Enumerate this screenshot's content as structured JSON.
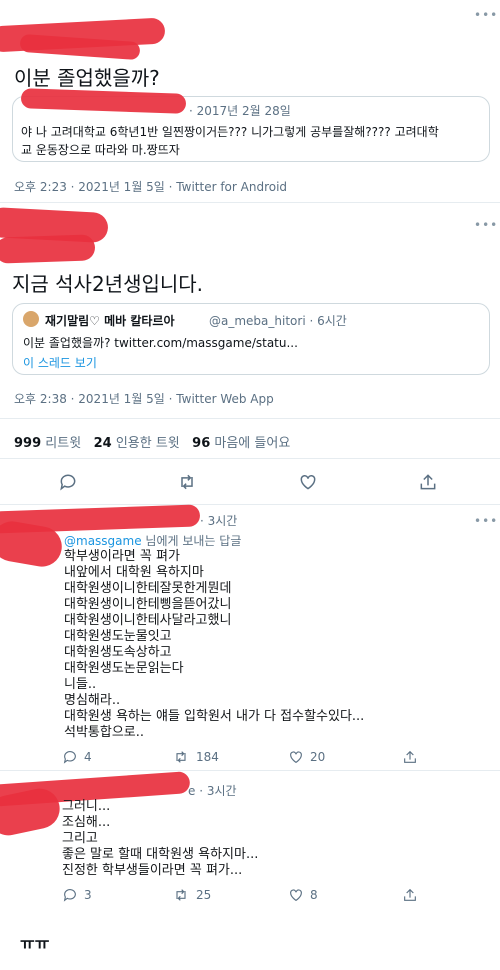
{
  "tweet1": {
    "text": "이분 졸업했을까?",
    "quote_date": "· 2017년 2월 28일",
    "quote_text_1": "야 나 고려대학교 6학년1반 일찐짱이거든??? 니가그렇게 공부를잘해???? 고려대학",
    "quote_text_2": "교 운동장으로 따라와 마.짱뜨자",
    "meta": "오후 2:23 · 2021년 1월 5일 · Twitter for Android"
  },
  "tweet2": {
    "text": "지금 석사2년생입니다.",
    "quote_name": "재기말림♡ 메바 칼타르아",
    "quote_handle": "@a_meba_hitori · 6시간",
    "quote_text": "이분 졸업했을까? twitter.com/massgame/statu...",
    "quote_thread_link": "이 스레드 보기",
    "meta": "오후 2:38 · 2021년 1월 5일 · Twitter Web App"
  },
  "stats": {
    "retweets_count": "999",
    "retweets_label": "리트윗",
    "quotes_count": "24",
    "quotes_label": "인용한 트윗",
    "likes_count": "96",
    "likes_label": "마음에 들어요"
  },
  "reply1": {
    "time": "· 3시간",
    "replying_handle": "@massgame",
    "replying_suffix": " 님에게 보내는 답글",
    "lines": [
      "학부생이라면 꼭 펴가",
      "내앞에서 대학원 욕하지마",
      "대학원생이니한테잘못한게뭔데",
      "대학원생이니한테삥을뜯어갔니",
      "대학원생이니한테사달라고했니",
      "대학원생도눈물잇고",
      "대학원생도속상하고",
      "대학원생도논문읽는다",
      "니들..",
      "명심해라..",
      "대학원생 욕하는 얘들 입학원서 내가 다 접수할수있다...",
      "석박통합으로.."
    ],
    "reply_count": "4",
    "retweet_count": "184",
    "like_count": "20"
  },
  "reply2": {
    "time": "e · 3시간",
    "lines": [
      "그러니...",
      "조심해...",
      "그리고",
      "좋은 말로 할때 대학원생 욕하지마...",
      "진정한 학부생들이라면 꼭 펴가..."
    ],
    "reply_count": "3",
    "retweet_count": "25",
    "like_count": "8"
  },
  "caption": "ㅠㅠ",
  "colors": {
    "accent": "#1b95e0",
    "redaction": "#e8303e",
    "muted": "#5b7083"
  }
}
